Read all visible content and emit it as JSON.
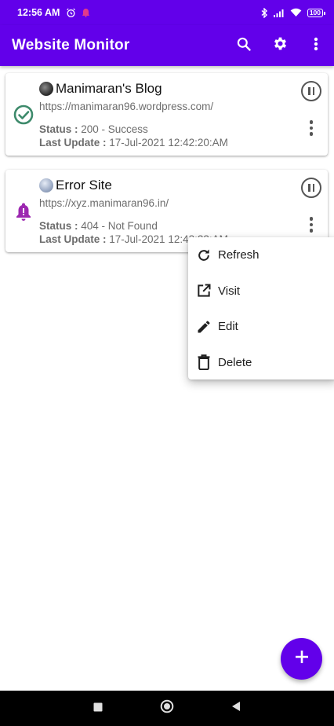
{
  "status_bar": {
    "time": "12:56 AM",
    "battery": "100",
    "icons": [
      "alarm-icon",
      "notification-dot-icon",
      "bluetooth-icon",
      "signal-icon",
      "wifi-icon",
      "battery-icon"
    ]
  },
  "app_bar": {
    "title": "Website Monitor",
    "actions": [
      "search-icon",
      "settings-icon",
      "more-vert-icon"
    ]
  },
  "sites": [
    {
      "name": "Manimaran's Blog",
      "url": "https://manimaran96.wordpress.com/",
      "status_label": "Status :",
      "status_value": " 200 - Success",
      "update_label": "Last Update :",
      "update_value": " 17-Jul-2021 12:42:20:AM",
      "state_icon": "check-circle-icon"
    },
    {
      "name": "Error Site",
      "url": "https://xyz.manimaran96.in/",
      "status_label": "Status :",
      "status_value": " 404 - Not Found",
      "update_label": "Last Update :",
      "update_value": " 17-Jul-2021 12:43:23:AM",
      "state_icon": "alert-bell-icon"
    }
  ],
  "menu": {
    "items": [
      {
        "label": "Refresh",
        "icon": "refresh-icon"
      },
      {
        "label": "Visit",
        "icon": "open-in-new-icon"
      },
      {
        "label": "Edit",
        "icon": "pencil-icon"
      },
      {
        "label": "Delete",
        "icon": "trash-icon"
      }
    ]
  },
  "fab": {
    "icon": "plus-icon"
  },
  "nav_bar": {
    "buttons": [
      "recents-button",
      "home-button",
      "back-button"
    ]
  },
  "colors": {
    "primary": "#6200ea",
    "success": "#3d8a6b",
    "error": "#9c27b0"
  }
}
